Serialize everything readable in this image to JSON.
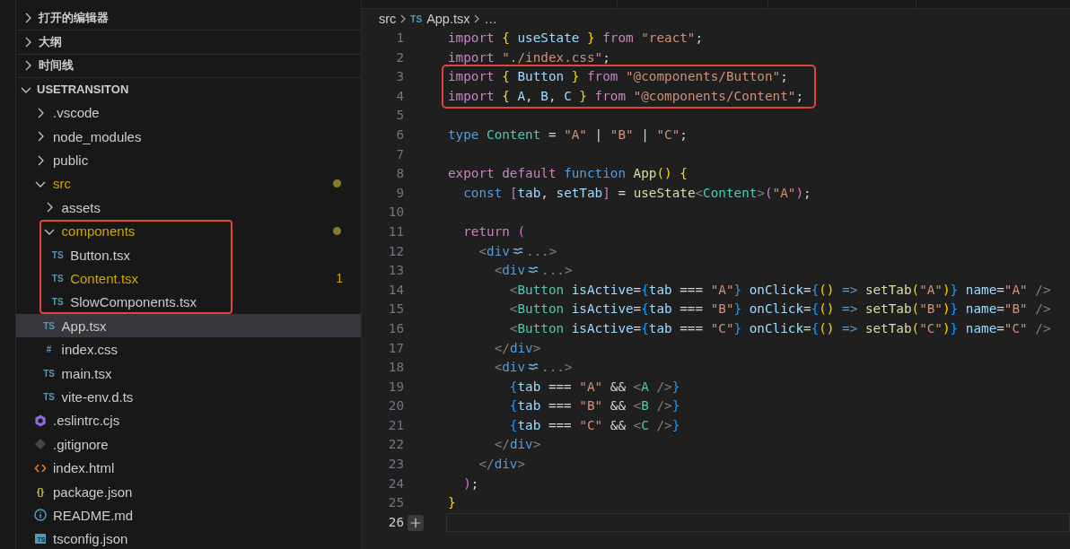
{
  "explorer": {
    "sections": [
      {
        "title": "打开的编辑器",
        "expanded": false
      },
      {
        "title": "大纲",
        "expanded": false
      },
      {
        "title": "时间线",
        "expanded": false
      }
    ],
    "project": {
      "title": "USETRANSITON",
      "expanded": true,
      "items": [
        {
          "name": ".vscode",
          "kind": "folder",
          "expanded": false,
          "modified": false,
          "selected": false
        },
        {
          "name": "node_modules",
          "kind": "folder",
          "expanded": false,
          "modified": false,
          "selected": false
        },
        {
          "name": "public",
          "kind": "folder",
          "expanded": false,
          "modified": false,
          "selected": false
        },
        {
          "name": "src",
          "kind": "folder",
          "expanded": true,
          "modified": true,
          "selected": false,
          "children": [
            {
              "name": "assets",
              "kind": "folder",
              "expanded": false,
              "modified": false,
              "selected": false
            },
            {
              "name": "components",
              "kind": "folder",
              "expanded": true,
              "modified": true,
              "selected": false,
              "boxed": true,
              "children": [
                {
                  "name": "Button.tsx",
                  "kind": "text-icon",
                  "icon": "TS",
                  "modified": false,
                  "selected": false
                },
                {
                  "name": "Content.tsx",
                  "kind": "text-icon",
                  "icon": "TS",
                  "modified": false,
                  "problems": "1",
                  "selected": false
                },
                {
                  "name": "SlowComponents.tsx",
                  "kind": "text-icon",
                  "icon": "TS",
                  "modified": false,
                  "selected": false
                }
              ]
            },
            {
              "name": "App.tsx",
              "kind": "text-icon",
              "icon": "TS",
              "modified": false,
              "selected": true
            },
            {
              "name": "index.css",
              "kind": "text-icon",
              "icon": "#",
              "modified": false,
              "selected": false
            },
            {
              "name": "main.tsx",
              "kind": "text-icon",
              "icon": "TS",
              "modified": false,
              "selected": false
            },
            {
              "name": "vite-env.d.ts",
              "kind": "text-icon",
              "icon": "TS",
              "modified": false,
              "selected": false
            }
          ]
        },
        {
          "name": ".eslintrc.cjs",
          "kind": "eslint",
          "modified": false,
          "selected": false
        },
        {
          "name": ".gitignore",
          "kind": "git",
          "modified": false,
          "selected": false
        },
        {
          "name": "index.html",
          "kind": "html",
          "modified": false,
          "selected": false
        },
        {
          "name": "package.json",
          "kind": "text-icon",
          "icon": "{}",
          "modified": false,
          "selected": false
        },
        {
          "name": "README.md",
          "kind": "info",
          "modified": false,
          "selected": false
        },
        {
          "name": "tsconfig.json",
          "kind": "box-icon",
          "icon": "TS",
          "modified": false,
          "selected": false
        }
      ]
    }
  },
  "editor": {
    "breadcrumb": [
      {
        "label": "src"
      },
      {
        "label": "App.tsx",
        "icon": "TS"
      },
      {
        "label": "…"
      }
    ],
    "lines": [
      {
        "n": "1",
        "current": false,
        "tokens": [
          {
            "kind": "ctrl",
            "text": "import "
          },
          {
            "kind": "b1",
            "text": "{ "
          },
          {
            "kind": "var",
            "text": "useState "
          },
          {
            "kind": "b1",
            "text": "} "
          },
          {
            "kind": "ctrl",
            "text": "from "
          },
          {
            "kind": "str",
            "text": "\"react\""
          },
          {
            "kind": "op",
            "text": ";"
          }
        ]
      },
      {
        "n": "2",
        "current": false,
        "tokens": [
          {
            "kind": "ctrl",
            "text": "import "
          },
          {
            "kind": "str",
            "text": "\"./index.css\""
          },
          {
            "kind": "op",
            "text": ";"
          }
        ]
      },
      {
        "n": "3",
        "current": false,
        "boxed": true,
        "tokens": [
          {
            "kind": "ctrl",
            "text": "import "
          },
          {
            "kind": "b1",
            "text": "{ "
          },
          {
            "kind": "var",
            "text": "Button "
          },
          {
            "kind": "b1",
            "text": "} "
          },
          {
            "kind": "ctrl",
            "text": "from "
          },
          {
            "kind": "str",
            "text": "\"@components/Button\""
          },
          {
            "kind": "op",
            "text": ";"
          }
        ]
      },
      {
        "n": "4",
        "current": false,
        "boxed": true,
        "tokens": [
          {
            "kind": "ctrl",
            "text": "import "
          },
          {
            "kind": "b1",
            "text": "{ "
          },
          {
            "kind": "var",
            "text": "A"
          },
          {
            "kind": "op",
            "text": ", "
          },
          {
            "kind": "var",
            "text": "B"
          },
          {
            "kind": "op",
            "text": ", "
          },
          {
            "kind": "var",
            "text": "C "
          },
          {
            "kind": "b1",
            "text": "} "
          },
          {
            "kind": "ctrl",
            "text": "from "
          },
          {
            "kind": "str",
            "text": "\"@components/Content\""
          },
          {
            "kind": "op",
            "text": ";"
          }
        ]
      },
      {
        "n": "5",
        "current": false
      },
      {
        "n": "6",
        "current": false,
        "tokens": [
          {
            "kind": "kw",
            "text": "type "
          },
          {
            "kind": "type",
            "text": "Content "
          },
          {
            "kind": "op",
            "text": "= "
          },
          {
            "kind": "str",
            "text": "\"A\" "
          },
          {
            "kind": "op",
            "text": "| "
          },
          {
            "kind": "str",
            "text": "\"B\" "
          },
          {
            "kind": "op",
            "text": "| "
          },
          {
            "kind": "str",
            "text": "\"C\""
          },
          {
            "kind": "op",
            "text": ";"
          }
        ]
      },
      {
        "n": "7",
        "current": false
      },
      {
        "n": "8",
        "current": false,
        "tokens": [
          {
            "kind": "ctrl",
            "text": "export default "
          },
          {
            "kind": "kw",
            "text": "function "
          },
          {
            "kind": "fn",
            "text": "App"
          },
          {
            "kind": "b1",
            "text": "() {"
          }
        ]
      },
      {
        "n": "9",
        "current": false,
        "tokens": [
          {
            "kind": "kw",
            "text": "  const "
          },
          {
            "kind": "b2",
            "text": "["
          },
          {
            "kind": "var",
            "text": "tab"
          },
          {
            "kind": "op",
            "text": ", "
          },
          {
            "kind": "var",
            "text": "setTab"
          },
          {
            "kind": "b2",
            "text": "] "
          },
          {
            "kind": "op",
            "text": "= "
          },
          {
            "kind": "fn",
            "text": "useState"
          },
          {
            "kind": "punct",
            "text": "<"
          },
          {
            "kind": "type",
            "text": "Content"
          },
          {
            "kind": "punct",
            "text": ">"
          },
          {
            "kind": "b2",
            "text": "("
          },
          {
            "kind": "str",
            "text": "\"A\""
          },
          {
            "kind": "b2",
            "text": ")"
          },
          {
            "kind": "op",
            "text": ";"
          }
        ]
      },
      {
        "n": "10",
        "current": false
      },
      {
        "n": "11",
        "current": false,
        "tokens": [
          {
            "kind": "ctrl",
            "text": "  return "
          },
          {
            "kind": "b2",
            "text": "("
          }
        ]
      },
      {
        "n": "12",
        "current": false,
        "tokens": [
          {
            "kind": "punct",
            "text": "    <"
          },
          {
            "kind": "tag",
            "text": "div"
          },
          {
            "kind": "fold"
          },
          {
            "kind": "punct",
            "text": "...>"
          }
        ]
      },
      {
        "n": "13",
        "current": false,
        "tokens": [
          {
            "kind": "punct",
            "text": "      <"
          },
          {
            "kind": "tag",
            "text": "div"
          },
          {
            "kind": "fold"
          },
          {
            "kind": "punct",
            "text": "...>"
          }
        ]
      },
      {
        "n": "14",
        "current": false,
        "tokens": [
          {
            "kind": "punct",
            "text": "        <"
          },
          {
            "kind": "type",
            "text": "Button "
          },
          {
            "kind": "var",
            "text": "isActive"
          },
          {
            "kind": "op",
            "text": "="
          },
          {
            "kind": "b3",
            "text": "{"
          },
          {
            "kind": "var",
            "text": "tab "
          },
          {
            "kind": "op",
            "text": "=== "
          },
          {
            "kind": "str",
            "text": "\"A\""
          },
          {
            "kind": "b3",
            "text": "} "
          },
          {
            "kind": "var",
            "text": "onClick"
          },
          {
            "kind": "op",
            "text": "="
          },
          {
            "kind": "b3",
            "text": "{"
          },
          {
            "kind": "b1",
            "text": "() "
          },
          {
            "kind": "kw",
            "text": "=> "
          },
          {
            "kind": "fn",
            "text": "setTab"
          },
          {
            "kind": "b1",
            "text": "("
          },
          {
            "kind": "str",
            "text": "\"A\""
          },
          {
            "kind": "b1",
            "text": ")"
          },
          {
            "kind": "b3",
            "text": "} "
          },
          {
            "kind": "var",
            "text": "name"
          },
          {
            "kind": "op",
            "text": "="
          },
          {
            "kind": "str",
            "text": "\"A\" "
          },
          {
            "kind": "punct",
            "text": "/>"
          }
        ]
      },
      {
        "n": "15",
        "current": false,
        "tokens": [
          {
            "kind": "punct",
            "text": "        <"
          },
          {
            "kind": "type",
            "text": "Button "
          },
          {
            "kind": "var",
            "text": "isActive"
          },
          {
            "kind": "op",
            "text": "="
          },
          {
            "kind": "b3",
            "text": "{"
          },
          {
            "kind": "var",
            "text": "tab "
          },
          {
            "kind": "op",
            "text": "=== "
          },
          {
            "kind": "str",
            "text": "\"B\""
          },
          {
            "kind": "b3",
            "text": "} "
          },
          {
            "kind": "var",
            "text": "onClick"
          },
          {
            "kind": "op",
            "text": "="
          },
          {
            "kind": "b3",
            "text": "{"
          },
          {
            "kind": "b1",
            "text": "() "
          },
          {
            "kind": "kw",
            "text": "=> "
          },
          {
            "kind": "fn",
            "text": "setTab"
          },
          {
            "kind": "b1",
            "text": "("
          },
          {
            "kind": "str",
            "text": "\"B\""
          },
          {
            "kind": "b1",
            "text": ")"
          },
          {
            "kind": "b3",
            "text": "} "
          },
          {
            "kind": "var",
            "text": "name"
          },
          {
            "kind": "op",
            "text": "="
          },
          {
            "kind": "str",
            "text": "\"B\" "
          },
          {
            "kind": "punct",
            "text": "/>"
          }
        ]
      },
      {
        "n": "16",
        "current": false,
        "tokens": [
          {
            "kind": "punct",
            "text": "        <"
          },
          {
            "kind": "type",
            "text": "Button "
          },
          {
            "kind": "var",
            "text": "isActive"
          },
          {
            "kind": "op",
            "text": "="
          },
          {
            "kind": "b3",
            "text": "{"
          },
          {
            "kind": "var",
            "text": "tab "
          },
          {
            "kind": "op",
            "text": "=== "
          },
          {
            "kind": "str",
            "text": "\"C\""
          },
          {
            "kind": "b3",
            "text": "} "
          },
          {
            "kind": "var",
            "text": "onClick"
          },
          {
            "kind": "op",
            "text": "="
          },
          {
            "kind": "b3",
            "text": "{"
          },
          {
            "kind": "b1",
            "text": "() "
          },
          {
            "kind": "kw",
            "text": "=> "
          },
          {
            "kind": "fn",
            "text": "setTab"
          },
          {
            "kind": "b1",
            "text": "("
          },
          {
            "kind": "str",
            "text": "\"C\""
          },
          {
            "kind": "b1",
            "text": ")"
          },
          {
            "kind": "b3",
            "text": "} "
          },
          {
            "kind": "var",
            "text": "name"
          },
          {
            "kind": "op",
            "text": "="
          },
          {
            "kind": "str",
            "text": "\"C\" "
          },
          {
            "kind": "punct",
            "text": "/>"
          }
        ]
      },
      {
        "n": "17",
        "current": false,
        "tokens": [
          {
            "kind": "punct",
            "text": "      </"
          },
          {
            "kind": "tag",
            "text": "div"
          },
          {
            "kind": "punct",
            "text": ">"
          }
        ]
      },
      {
        "n": "18",
        "current": false,
        "tokens": [
          {
            "kind": "punct",
            "text": "      <"
          },
          {
            "kind": "tag",
            "text": "div"
          },
          {
            "kind": "fold"
          },
          {
            "kind": "punct",
            "text": "...>"
          }
        ]
      },
      {
        "n": "19",
        "current": false,
        "tokens": [
          {
            "kind": "b3",
            "text": "        {"
          },
          {
            "kind": "var",
            "text": "tab "
          },
          {
            "kind": "op",
            "text": "=== "
          },
          {
            "kind": "str",
            "text": "\"A\" "
          },
          {
            "kind": "op",
            "text": "&& "
          },
          {
            "kind": "punct",
            "text": "<"
          },
          {
            "kind": "type",
            "text": "A "
          },
          {
            "kind": "punct",
            "text": "/>"
          },
          {
            "kind": "b3",
            "text": "}"
          }
        ]
      },
      {
        "n": "20",
        "current": false,
        "tokens": [
          {
            "kind": "b3",
            "text": "        {"
          },
          {
            "kind": "var",
            "text": "tab "
          },
          {
            "kind": "op",
            "text": "=== "
          },
          {
            "kind": "str",
            "text": "\"B\" "
          },
          {
            "kind": "op",
            "text": "&& "
          },
          {
            "kind": "punct",
            "text": "<"
          },
          {
            "kind": "type",
            "text": "B "
          },
          {
            "kind": "punct",
            "text": "/>"
          },
          {
            "kind": "b3",
            "text": "}"
          }
        ]
      },
      {
        "n": "21",
        "current": false,
        "tokens": [
          {
            "kind": "b3",
            "text": "        {"
          },
          {
            "kind": "var",
            "text": "tab "
          },
          {
            "kind": "op",
            "text": "=== "
          },
          {
            "kind": "str",
            "text": "\"C\" "
          },
          {
            "kind": "op",
            "text": "&& "
          },
          {
            "kind": "punct",
            "text": "<"
          },
          {
            "kind": "type",
            "text": "C "
          },
          {
            "kind": "punct",
            "text": "/>"
          },
          {
            "kind": "b3",
            "text": "}"
          }
        ]
      },
      {
        "n": "22",
        "current": false,
        "tokens": [
          {
            "kind": "punct",
            "text": "      </"
          },
          {
            "kind": "tag",
            "text": "div"
          },
          {
            "kind": "punct",
            "text": ">"
          }
        ]
      },
      {
        "n": "23",
        "current": false,
        "tokens": [
          {
            "kind": "punct",
            "text": "    </"
          },
          {
            "kind": "tag",
            "text": "div"
          },
          {
            "kind": "punct",
            "text": ">"
          }
        ]
      },
      {
        "n": "24",
        "current": false,
        "tokens": [
          {
            "kind": "b2",
            "text": "  )"
          },
          {
            "kind": "op",
            "text": ";"
          }
        ]
      },
      {
        "n": "25",
        "current": false,
        "tokens": [
          {
            "kind": "b1",
            "text": "}"
          }
        ]
      },
      {
        "n": "26",
        "current": true
      }
    ]
  }
}
